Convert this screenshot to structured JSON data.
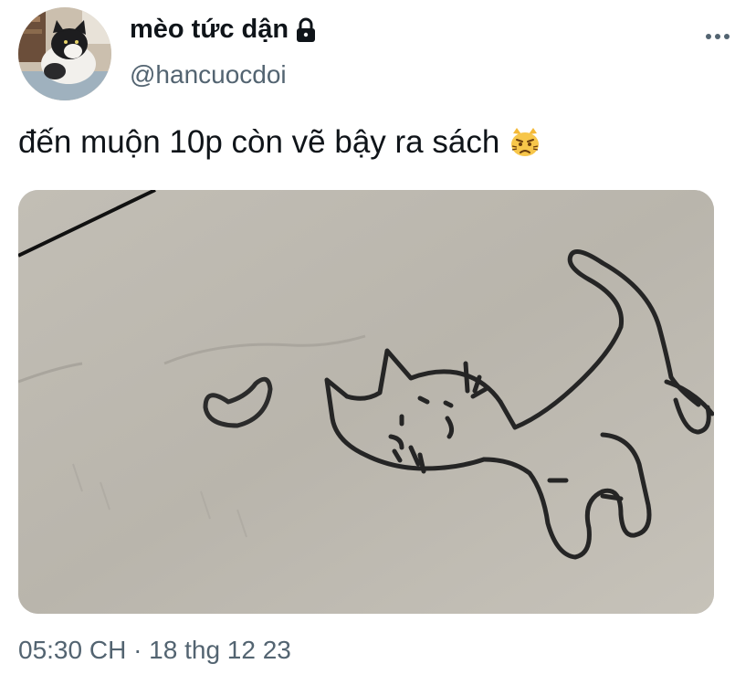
{
  "author": {
    "display_name": "mèo tức dận",
    "handle": "@hancuocdoi",
    "avatar_icon": "cat-photo-avatar",
    "protected_icon": "lock-icon"
  },
  "tweet": {
    "text": "đến muộn 10p còn vẽ bậy ra sách",
    "emoji_icon": "pouting-cat-emoji",
    "media_icon": "cat-doodle-photo",
    "timestamp": "05:30 CH · 18 thg 12 23"
  },
  "actions": {
    "more_icon": "more-options-icon"
  },
  "colors": {
    "text_primary": "#0f1419",
    "text_secondary": "#536471",
    "background": "#ffffff"
  }
}
